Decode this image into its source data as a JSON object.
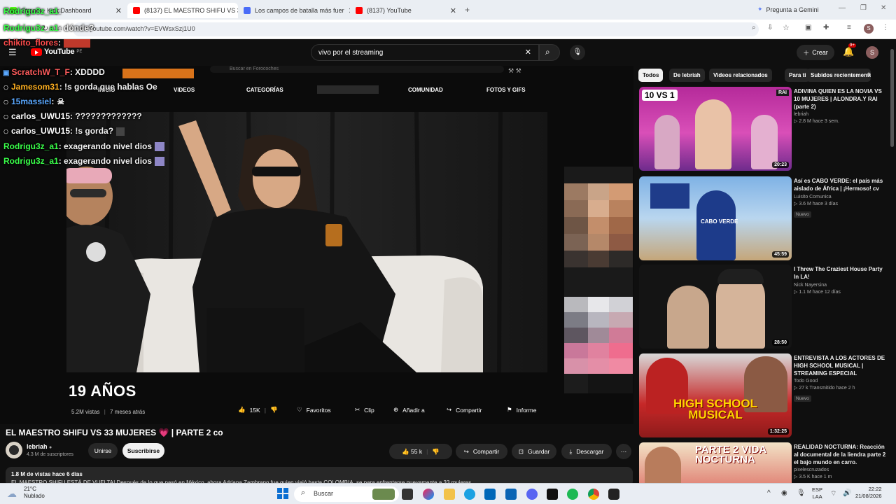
{
  "browser": {
    "tabs": [
      {
        "label": "Stream - Kick Dashboard",
        "fav": "#53fc18"
      },
      {
        "label": "(8137) EL MAESTRO SHIFU VS 3",
        "fav": "#ff0000"
      },
      {
        "label": "Los campos de batalla más fuer",
        "fav": "#4a6cf7"
      },
      {
        "label": "(8137) YouTube",
        "fav": "#ff0000"
      }
    ],
    "gemini_label": "Pregunta a Gemini",
    "url": "youtube.com/watch?v=EVWsxSzj1U0",
    "profile_initial": "S"
  },
  "youtube": {
    "logo": "YouTube",
    "logo_suffix": "PE",
    "search_value": "vivo por el streaming",
    "create_label": "Crear",
    "notif_count": "9+",
    "avatar_initial": "S"
  },
  "video_frame": {
    "inner_nav": [
      "INICIO",
      "VIDEOS",
      "CATEGORÍAS",
      "COMUNIDAD",
      "FOTOS Y GIFS"
    ],
    "inner_search_placeholder": "Buscar en Forocoches",
    "big_title": "19 AÑOS",
    "views": "5.2M vistas",
    "age": "7 meses atrás",
    "like_count": "15K",
    "actions": {
      "favorites": "Favoritos",
      "clip": "Clip",
      "add": "Añadir a",
      "share": "Compartir",
      "report": "Informe"
    }
  },
  "chat": [
    {
      "user": "Rodrigu3z_a1",
      "msg": ": ",
      "color": "#3aff4a"
    },
    {
      "user": "Rodrigu3z_a1",
      "msg": ": dónde?",
      "color": "#3aff4a"
    },
    {
      "user": "chikito_flores",
      "msg": ":",
      "color": "#ff4d4d"
    },
    {
      "user": "ScratchW_T_F",
      "msg": ": XDDDD",
      "color": "#ff5c5c"
    },
    {
      "user": "Jamesom31",
      "msg": ": !s gorda que hablas Oe",
      "color": "#ffb020"
    },
    {
      "user": "15massiel",
      "msg": ":",
      "color": "#5aa8ff"
    },
    {
      "user": "carlos_UWU15",
      "msg": ": ?????????????",
      "color": "#ffffff"
    },
    {
      "user": "carlos_UWU15",
      "msg": ": !s gorda?",
      "color": "#ffffff"
    },
    {
      "user": "Rodrigu3z_a1",
      "msg": ": exagerando nivel dios",
      "color": "#3aff4a"
    },
    {
      "user": "Rodrigu3z_a1",
      "msg": ": exagerando nivel dios",
      "color": "#3aff4a"
    }
  ],
  "main_video": {
    "title": "EL MAESTRO SHIFU VS 33 MUJERES 💗 | PARTE 2 co",
    "channel": "lebriah",
    "subscribers": "4.3 M de suscriptores",
    "join": "Unirse",
    "subscribe": "Suscribirse",
    "likes": "55 k",
    "share": "Compartir",
    "save": "Guardar",
    "download": "Descargar",
    "desc_meta": "1.8 M de vistas  hace 6 días",
    "desc_text": "EL MAESTRO SHIFU ESTÁ DE VUELTA! Después de lo que pasó en México, ahora Adriana Zambrano fue quien viajó hasta COLOMBIA, se para enfrentarse nuevamente a 33 mujeres"
  },
  "sidebar": {
    "chips": [
      "Todos",
      "De lebriah",
      "Videos relacionados",
      "Para ti",
      "Subidos recientemente"
    ],
    "videos": [
      {
        "title": "ADIVINA QUIEN ES LA NOVIA VS 10 MUJERES | ALONDRA.Y RAI (parte 2)",
        "channel": "lebriah",
        "meta": "2.8 M  hace 3 sem.",
        "duration": "20:23",
        "badge": ""
      },
      {
        "title": "Así es CABO VERDE: el país más aislado de África | ¡Hermoso! cv",
        "channel": "Luisito Comunica",
        "meta": "3.6 M  hace 3 días",
        "duration": "45:59",
        "badge": "Nuevo"
      },
      {
        "title": "I Threw The Craziest House Party In LA!",
        "channel": "Nick Nayersina",
        "meta": "1.1 M  hace 12 días",
        "duration": "28:50",
        "badge": ""
      },
      {
        "title": "ENTREVISTA A LOS ACTORES DE HIGH SCHOOL MUSICAL | STREAMING ESPECIAL",
        "channel": "Todo Good",
        "meta": "27 k  Transmitido hace 2 h",
        "duration": "1:32:25",
        "badge": "Nuevo"
      },
      {
        "title": "REALIDAD NOCTURNA: Reacción al documental de la liendra parte 2 el bajo mundo en carro.",
        "channel": "pixelescruzados",
        "meta": "3.5 K  hace 1 m",
        "duration": "",
        "badge": ""
      }
    ],
    "thumb_texts": [
      "10 VS 1",
      "CABO VERDE",
      "",
      "HIGH SCHOOL MUSICAL",
      "PARTE 2 VIDA NOCTURNA"
    ]
  },
  "taskbar": {
    "weather_temp": "21°C",
    "weather_desc": "Nublado",
    "search_label": "Buscar",
    "lang": "ESP",
    "lang2": "LAA",
    "time": "22:22",
    "date": "21/08/2026"
  }
}
